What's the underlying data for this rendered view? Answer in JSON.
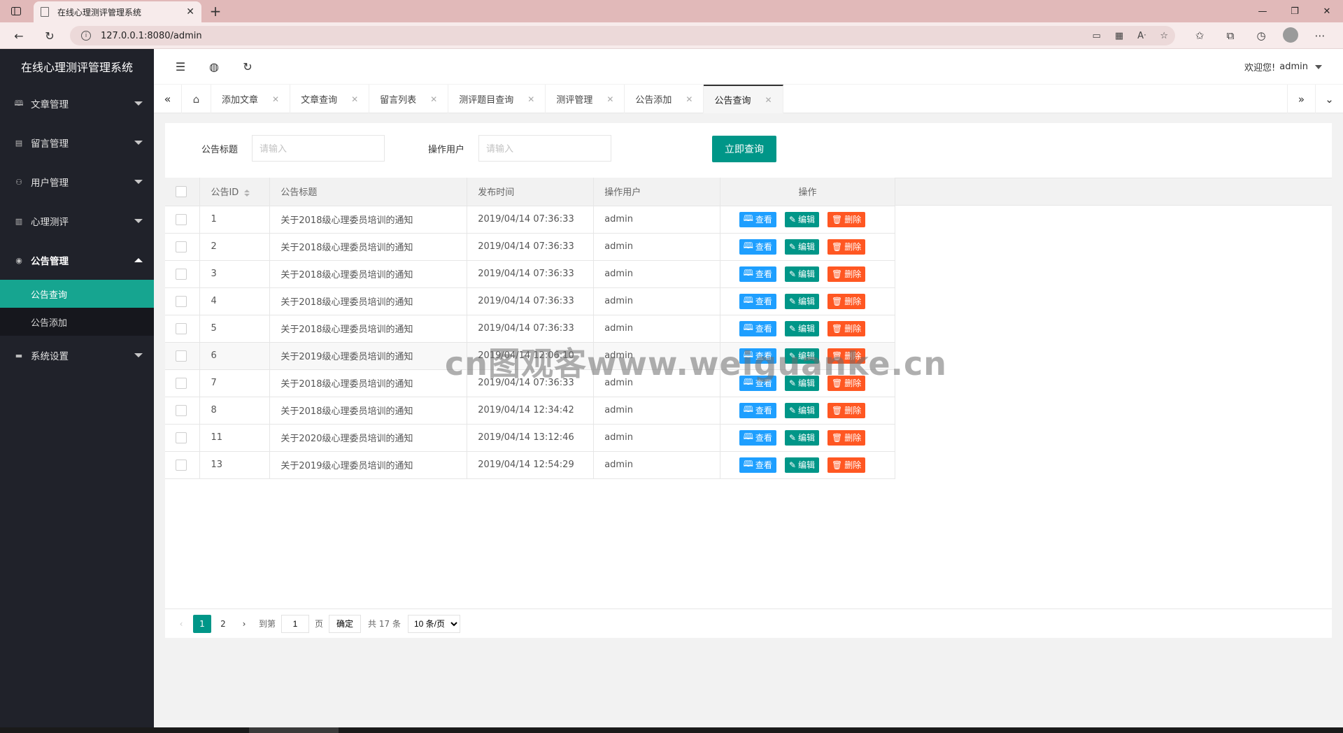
{
  "browser": {
    "tab_title": "在线心理测评管理系统",
    "tab_close": "✕",
    "new_tab": "+",
    "url": "127.0.0.1:8080/admin",
    "window_controls": {
      "minimize": "—",
      "restore": "❐",
      "close": "✕"
    }
  },
  "app": {
    "logo": "在线心理测评管理系统",
    "welcome_text": "欢迎您!",
    "username": "admin"
  },
  "sidebar": {
    "items": [
      {
        "label": "文章管理",
        "icon": "book-icon",
        "glyph": "🕮"
      },
      {
        "label": "留言管理",
        "icon": "message-icon",
        "glyph": "▤"
      },
      {
        "label": "用户管理",
        "icon": "user-icon",
        "glyph": "⚇"
      },
      {
        "label": "心理测评",
        "icon": "clipboard-icon",
        "glyph": "▥"
      },
      {
        "label": "公告管理",
        "icon": "notice-icon",
        "glyph": "◉"
      },
      {
        "label": "系统设置",
        "icon": "settings-icon",
        "glyph": "▬"
      }
    ],
    "submenu": [
      {
        "label": "公告查询"
      },
      {
        "label": "公告添加"
      }
    ]
  },
  "tabbar": {
    "tabs": [
      {
        "label": "添加文章"
      },
      {
        "label": "文章查询"
      },
      {
        "label": "留言列表"
      },
      {
        "label": "测评题目查询"
      },
      {
        "label": "测评管理"
      },
      {
        "label": "公告添加"
      },
      {
        "label": "公告查询"
      }
    ],
    "close_glyph": "✕"
  },
  "search": {
    "title_label": "公告标题",
    "title_placeholder": "请输入",
    "user_label": "操作用户",
    "user_placeholder": "请输入",
    "submit_label": "立即查询"
  },
  "table": {
    "columns": [
      "公告ID",
      "公告标题",
      "发布时间",
      "操作用户",
      "操作"
    ],
    "action_labels": {
      "view": "查看",
      "edit": "编辑",
      "delete": "删除"
    },
    "rows": [
      {
        "id": "1",
        "title": "关于2018级心理委员培训的通知",
        "time": "2019/04/14 07:36:33",
        "user": "admin"
      },
      {
        "id": "2",
        "title": "关于2018级心理委员培训的通知",
        "time": "2019/04/14 07:36:33",
        "user": "admin"
      },
      {
        "id": "3",
        "title": "关于2018级心理委员培训的通知",
        "time": "2019/04/14 07:36:33",
        "user": "admin"
      },
      {
        "id": "4",
        "title": "关于2018级心理委员培训的通知",
        "time": "2019/04/14 07:36:33",
        "user": "admin"
      },
      {
        "id": "5",
        "title": "关于2018级心理委员培训的通知",
        "time": "2019/04/14 07:36:33",
        "user": "admin"
      },
      {
        "id": "6",
        "title": "关于2019级心理委员培训的通知",
        "time": "2019/04/14 12:06:10",
        "user": "admin"
      },
      {
        "id": "7",
        "title": "关于2018级心理委员培训的通知",
        "time": "2019/04/14 07:36:33",
        "user": "admin"
      },
      {
        "id": "8",
        "title": "关于2018级心理委员培训的通知",
        "time": "2019/04/14 12:34:42",
        "user": "admin"
      },
      {
        "id": "11",
        "title": "关于2020级心理委员培训的通知",
        "time": "2019/04/14 13:12:46",
        "user": "admin"
      },
      {
        "id": "13",
        "title": "关于2019级心理委员培训的通知",
        "time": "2019/04/14 12:54:29",
        "user": "admin"
      }
    ]
  },
  "pagination": {
    "prev": "‹",
    "pages": [
      "1",
      "2"
    ],
    "current": "1",
    "next": "›",
    "goto_label": "到第",
    "goto_value": "1",
    "page_unit": "页",
    "confirm_label": "确定",
    "total_label": "共 17 条",
    "per_page": "10 条/页"
  },
  "watermark": "cn图观客www.weiguanke.cn",
  "colors": {
    "accent": "#009688",
    "sidebar_bg": "#20222a",
    "sidebar_active": "#16a590",
    "view_btn": "#1e9fff",
    "delete_btn": "#ff5722",
    "browser_tabstrip": "#e1b9b9"
  }
}
